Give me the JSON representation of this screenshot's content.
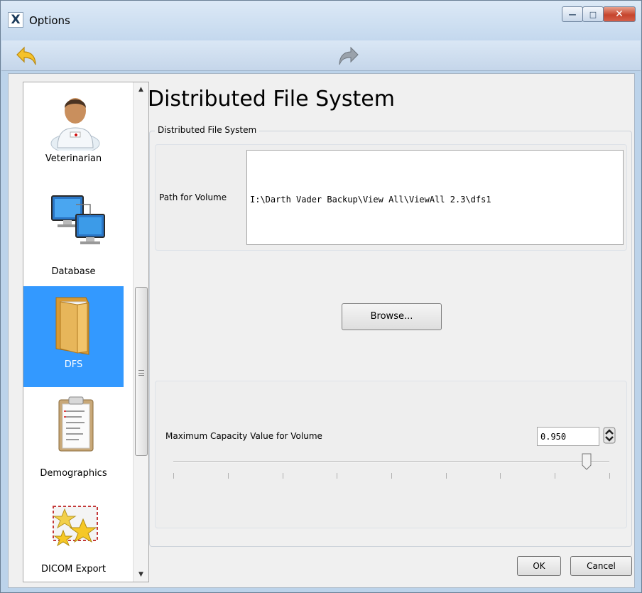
{
  "window": {
    "title": "Options",
    "app_icon_letter": "X"
  },
  "toolbar": {
    "back_icon": "back-arrow-icon",
    "forward_icon": "forward-arrow-icon"
  },
  "sidebar": {
    "items": [
      {
        "label": "Veterinarian",
        "icon": "veterinarian-icon"
      },
      {
        "label": "Database",
        "icon": "database-computers-icon"
      },
      {
        "label": "DFS",
        "icon": "folder-icon",
        "selected": true
      },
      {
        "label": "Demographics",
        "icon": "clipboard-icon"
      },
      {
        "label": "DICOM Export",
        "icon": "stars-envelope-icon"
      }
    ]
  },
  "main": {
    "title": "Distributed File System",
    "group_title": "Distributed File System",
    "path_label": "Path for Volume",
    "path_value": "I:\\Darth Vader Backup\\View All\\ViewAll 2.3\\dfs1",
    "browse_label": "Browse...",
    "capacity_label": "Maximum Capacity Value for Volume",
    "capacity_value": "0.950",
    "slider_fraction": 0.95
  },
  "footer": {
    "ok_label": "OK",
    "cancel_label": "Cancel"
  },
  "colors": {
    "selection": "#3399ff",
    "close_button": "#c6452d",
    "window_frame": "#bcd3ea"
  }
}
